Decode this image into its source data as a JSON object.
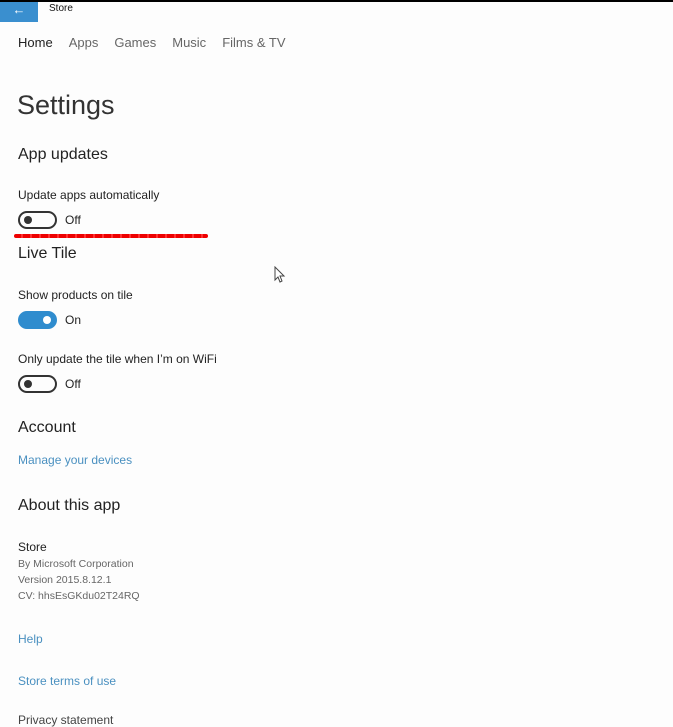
{
  "window": {
    "title": "Store",
    "back_icon": "arrow-left-icon"
  },
  "nav": {
    "items": [
      "Home",
      "Apps",
      "Games",
      "Music",
      "Films & TV"
    ],
    "active": "Home"
  },
  "page": {
    "title": "Settings"
  },
  "app_updates": {
    "heading": "App updates",
    "update_auto": {
      "label": "Update apps automatically",
      "state": "Off",
      "on": false
    }
  },
  "live_tile": {
    "heading": "Live Tile",
    "show_products": {
      "label": "Show products on tile",
      "state": "On",
      "on": true
    },
    "wifi_only": {
      "label": "Only update the tile when I’m on WiFi",
      "state": "Off",
      "on": false
    }
  },
  "account": {
    "heading": "Account",
    "manage_link": "Manage your devices"
  },
  "about": {
    "heading": "About this app",
    "name": "Store",
    "publisher": "By Microsoft Corporation",
    "version": "Version 2015.8.12.1",
    "cv": "CV: hhsEsGKdu02T24RQ"
  },
  "links": {
    "help": "Help",
    "terms": "Store terms of use",
    "privacy": "Privacy statement"
  },
  "colors": {
    "accent": "#2f8cce",
    "link": "#4a90c0",
    "annotation": "#e00000"
  }
}
